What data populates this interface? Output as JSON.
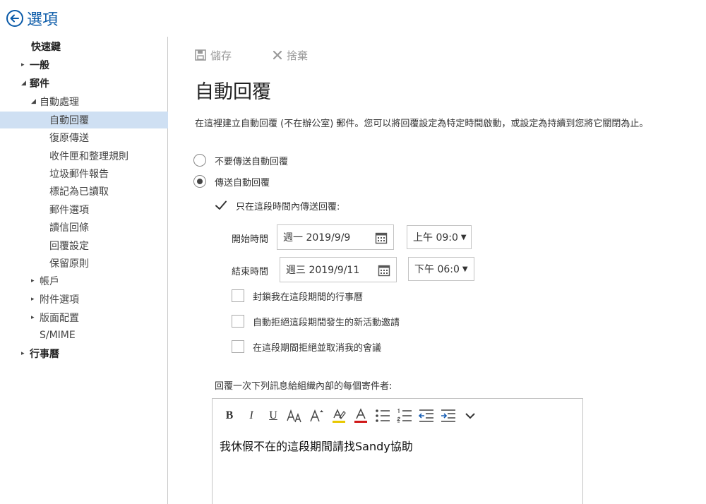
{
  "header": {
    "title": "選項"
  },
  "sidebar": {
    "items": [
      {
        "label": "快速鍵",
        "level": 0,
        "expander": ""
      },
      {
        "label": "一般",
        "level": 0,
        "expander": "▸"
      },
      {
        "label": "郵件",
        "level": 0,
        "expander": "◢"
      },
      {
        "label": "自動處理",
        "level": 1,
        "expander": "◢"
      },
      {
        "label": "自動回覆",
        "level": 2,
        "expander": "",
        "selected": true
      },
      {
        "label": "復原傳送",
        "level": 2,
        "expander": ""
      },
      {
        "label": "收件匣和整理規則",
        "level": 2,
        "expander": ""
      },
      {
        "label": "垃圾郵件報告",
        "level": 2,
        "expander": ""
      },
      {
        "label": "標記為已讀取",
        "level": 2,
        "expander": ""
      },
      {
        "label": "郵件選項",
        "level": 2,
        "expander": ""
      },
      {
        "label": "讀信回條",
        "level": 2,
        "expander": ""
      },
      {
        "label": "回覆設定",
        "level": 2,
        "expander": ""
      },
      {
        "label": "保留原則",
        "level": 2,
        "expander": ""
      },
      {
        "label": "帳戶",
        "level": 1,
        "expander": "▸"
      },
      {
        "label": "附件選項",
        "level": 1,
        "expander": "▸"
      },
      {
        "label": "版面配置",
        "level": 1,
        "expander": "▸"
      },
      {
        "label": "S/MIME",
        "level": 1,
        "expander": ""
      },
      {
        "label": "行事曆",
        "level": 0,
        "expander": "▸"
      }
    ]
  },
  "toolbar": {
    "save_label": "儲存",
    "discard_label": "捨棄"
  },
  "main": {
    "title": "自動回覆",
    "description": "在這裡建立自動回覆 (不在辦公室) 郵件。您可以將回覆設定為特定時間啟動，或設定為持續到您將它關閉為止。",
    "radio_no_reply": "不要傳送自動回覆",
    "radio_send_reply": "傳送自動回覆",
    "only_during_period": "只在這段時間內傳送回覆:",
    "start_label": "開始時間",
    "start_date": "週一 2019/9/9",
    "start_time": "上午 09:0",
    "end_label": "結束時間",
    "end_date": "週三 2019/9/11",
    "end_time": "下午 06:0",
    "option_block_calendar": "封鎖我在這段期間的行事曆",
    "option_decline_new": "自動拒絕這段期間發生的新活動邀請",
    "option_cancel_meetings": "在這段期間拒絕並取消我的會議",
    "inside_org_label": "回覆一次下列訊息給組織內部的每個寄件者:",
    "message_body": "我休假不在的這段期間請找Sandy協助"
  },
  "editor_toolbar": {
    "bold": "B",
    "italic": "I",
    "underline": "U"
  },
  "colors": {
    "accent": "#0a5aa8",
    "selected_bg": "#cfe0f3",
    "highlight_yellow": "#e8c800",
    "font_red": "#d01818"
  }
}
